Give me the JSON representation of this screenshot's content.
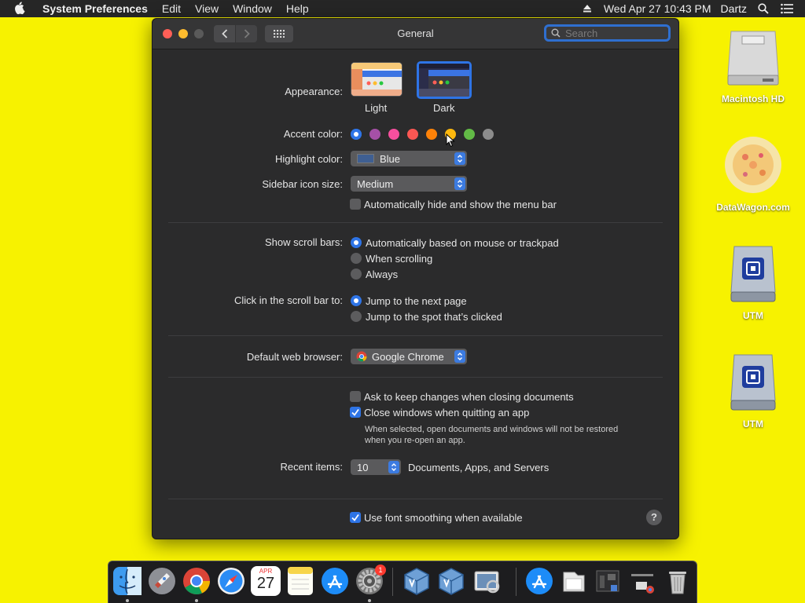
{
  "menubar": {
    "app": "System Preferences",
    "items": [
      "Edit",
      "View",
      "Window",
      "Help"
    ],
    "clock": "Wed Apr 27  10:43 PM",
    "user": "Dartz"
  },
  "window": {
    "title": "General",
    "search_placeholder": "Search"
  },
  "appearance": {
    "label": "Appearance:",
    "options": [
      "Light",
      "Dark"
    ],
    "selected": "Dark"
  },
  "accent": {
    "label": "Accent color:",
    "colors": [
      "#2e74e6",
      "#a550a7",
      "#f74f9e",
      "#fc5753",
      "#fd8208",
      "#fdb80e",
      "#62ba46",
      "#8c8c8c"
    ]
  },
  "highlight": {
    "label": "Highlight color:",
    "value": "Blue",
    "swatch": "#3f5f92"
  },
  "sidebar_size": {
    "label": "Sidebar icon size:",
    "value": "Medium"
  },
  "menu_bar_toggle": {
    "label": "Automatically hide and show the menu bar",
    "checked": false
  },
  "scroll_bars": {
    "label": "Show scroll bars:",
    "options": [
      "Automatically based on mouse or trackpad",
      "When scrolling",
      "Always"
    ]
  },
  "scroll_click": {
    "label": "Click in the scroll bar to:",
    "options": [
      "Jump to the next page",
      "Jump to the spot that’s clicked"
    ]
  },
  "browser": {
    "label": "Default web browser:",
    "value": "Google Chrome"
  },
  "docs": {
    "ask_keep": "Ask to keep changes when closing documents",
    "close_windows": "Close windows when quitting an app",
    "note_line1": "When selected, open documents and windows will not be restored",
    "note_line2": "when you re-open an app."
  },
  "recent": {
    "label": "Recent items:",
    "value": "10",
    "suffix": "Documents, Apps, and Servers"
  },
  "font_smoothing": {
    "label": "Use font smoothing when available"
  },
  "help": {
    "label": "?"
  },
  "desktop": {
    "icons": [
      "Macintosh HD",
      "DataWagon.com",
      "UTM",
      "UTM"
    ]
  },
  "dock": {
    "calendar_month": "APR",
    "calendar_day": "27",
    "badge": "1"
  }
}
